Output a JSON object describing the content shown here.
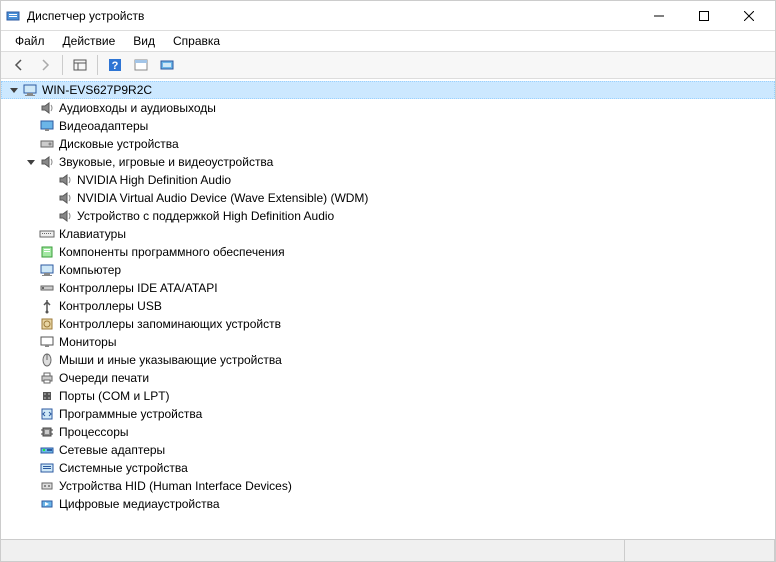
{
  "window": {
    "title": "Диспетчер устройств"
  },
  "menu": {
    "file": "Файл",
    "action": "Действие",
    "view": "Вид",
    "help": "Справка"
  },
  "tree": {
    "root": {
      "label": "WIN-EVS627P9R2C",
      "expanded": true,
      "selected": true,
      "children": [
        {
          "label": "Аудиовходы и аудиовыходы",
          "icon": "speaker",
          "expanded": false
        },
        {
          "label": "Видеоадаптеры",
          "icon": "display",
          "expanded": false
        },
        {
          "label": "Дисковые устройства",
          "icon": "disk",
          "expanded": false
        },
        {
          "label": "Звуковые, игровые и видеоустройства",
          "icon": "speaker",
          "expanded": true,
          "children": [
            {
              "label": "NVIDIA High Definition Audio",
              "icon": "speaker"
            },
            {
              "label": "NVIDIA Virtual Audio Device (Wave Extensible) (WDM)",
              "icon": "speaker"
            },
            {
              "label": "Устройство с поддержкой High Definition Audio",
              "icon": "speaker"
            }
          ]
        },
        {
          "label": "Клавиатуры",
          "icon": "keyboard",
          "expanded": false
        },
        {
          "label": "Компоненты программного обеспечения",
          "icon": "software",
          "expanded": false
        },
        {
          "label": "Компьютер",
          "icon": "computer",
          "expanded": false
        },
        {
          "label": "Контроллеры IDE ATA/ATAPI",
          "icon": "ide",
          "expanded": false
        },
        {
          "label": "Контроллеры USB",
          "icon": "usb",
          "expanded": false
        },
        {
          "label": "Контроллеры запоминающих устройств",
          "icon": "storage",
          "expanded": false
        },
        {
          "label": "Мониторы",
          "icon": "monitor",
          "expanded": false
        },
        {
          "label": "Мыши и иные указывающие устройства",
          "icon": "mouse",
          "expanded": false
        },
        {
          "label": "Очереди печати",
          "icon": "printer",
          "expanded": false
        },
        {
          "label": "Порты (COM и LPT)",
          "icon": "port",
          "expanded": false
        },
        {
          "label": "Программные устройства",
          "icon": "softdev",
          "expanded": false
        },
        {
          "label": "Процессоры",
          "icon": "cpu",
          "expanded": false
        },
        {
          "label": "Сетевые адаптеры",
          "icon": "network",
          "expanded": false
        },
        {
          "label": "Системные устройства",
          "icon": "system",
          "expanded": false
        },
        {
          "label": "Устройства HID (Human Interface Devices)",
          "icon": "hid",
          "expanded": false
        },
        {
          "label": "Цифровые медиаустройства",
          "icon": "media",
          "expanded": false
        }
      ]
    }
  }
}
